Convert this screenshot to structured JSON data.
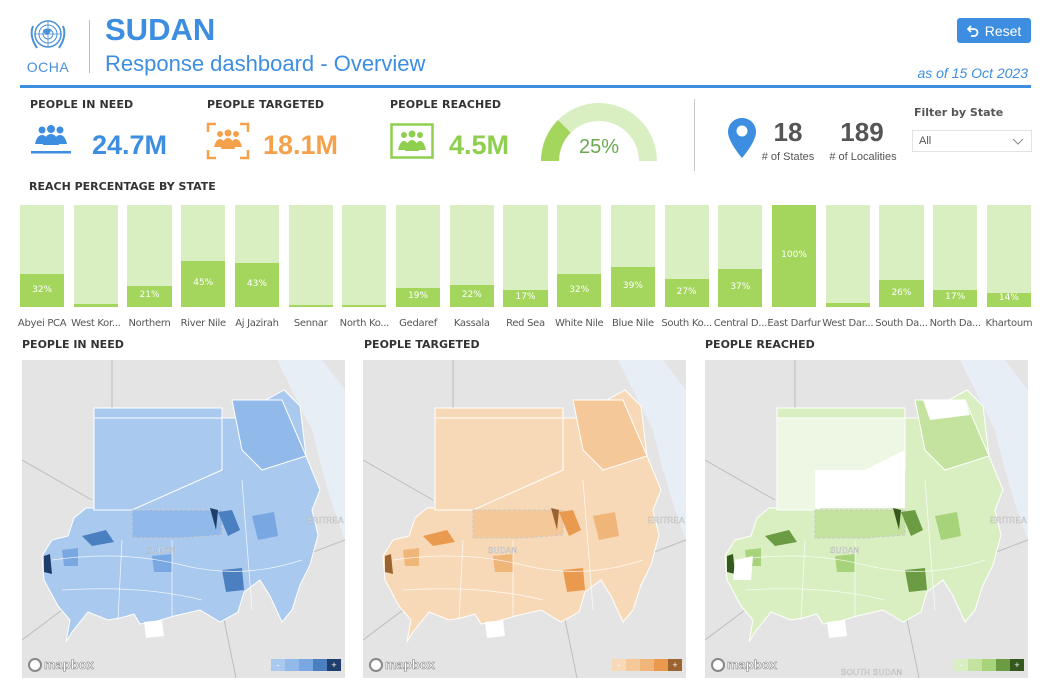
{
  "header": {
    "logo_text": "OCHA",
    "title": "SUDAN",
    "subtitle": "Response dashboard - Overview",
    "reset_label": "Reset",
    "as_of": "as of 15 Oct 2023"
  },
  "kpis": {
    "people_in_need": {
      "label": "PEOPLE IN NEED",
      "value": "24.7M",
      "color": "#3d8ee0"
    },
    "people_targeted": {
      "label": "PEOPLE TARGETED",
      "value": "18.1M",
      "color": "#f5a04b"
    },
    "people_reached": {
      "label": "PEOPLE REACHED",
      "value": "4.5M",
      "color": "#8fcf4f"
    },
    "reach_gauge": {
      "percent": 25,
      "label": "25%"
    }
  },
  "stats": {
    "states": {
      "value": "18",
      "label": "# of States"
    },
    "localities": {
      "value": "189",
      "label": "# of Localities"
    }
  },
  "filter": {
    "label": "Filter by State",
    "selected": "All"
  },
  "sections": {
    "reach_by_state": "REACH PERCENTAGE BY STATE",
    "map_need": "PEOPLE IN NEED",
    "map_targeted": "PEOPLE TARGETED",
    "map_reached": "PEOPLE REACHED"
  },
  "maps": {
    "attribution": "mapbox",
    "labels": {
      "sudan": "SUDAN",
      "eritrea": "ERITREA",
      "south_sudan": "SOUTH SUDAN"
    },
    "need_colors": [
      "#aac9ef",
      "#91b9ea",
      "#78a7e2",
      "#4a7fc0",
      "#1f3e6b"
    ],
    "targeted_colors": [
      "#f8d9b7",
      "#f5c89a",
      "#f0b579",
      "#e99a4f",
      "#9a6330"
    ],
    "reached_colors": [
      "#d9efc1",
      "#c3e39f",
      "#a7d37a",
      "#6b9b43",
      "#35581f"
    ]
  },
  "chart_data": {
    "type": "bar",
    "title": "REACH PERCENTAGE BY STATE",
    "categories": [
      "Abyei PCA",
      "West Kor...",
      "Northern",
      "River Nile",
      "Aj Jazirah",
      "Sennar",
      "North Ko...",
      "Gedaref",
      "Kassala",
      "Red Sea",
      "White Nile",
      "Blue Nile",
      "South Ko...",
      "Central D...",
      "East Darfur",
      "West Dar...",
      "South Da...",
      "North Da...",
      "Khartoum"
    ],
    "values": [
      32,
      3,
      21,
      45,
      43,
      1,
      1,
      19,
      22,
      17,
      32,
      39,
      27,
      37,
      100,
      4,
      26,
      17,
      14
    ],
    "labels": [
      "32%",
      "",
      "21%",
      "45%",
      "43%",
      "",
      "",
      "19%",
      "22%",
      "17%",
      "32%",
      "39%",
      "27%",
      "37%",
      "100%",
      "",
      "26%",
      "17%",
      "14%"
    ],
    "ylim": [
      0,
      100
    ],
    "xlabel": "",
    "ylabel": "",
    "colors": {
      "fill": "#a4d65e",
      "background": "#d9efc1"
    }
  }
}
